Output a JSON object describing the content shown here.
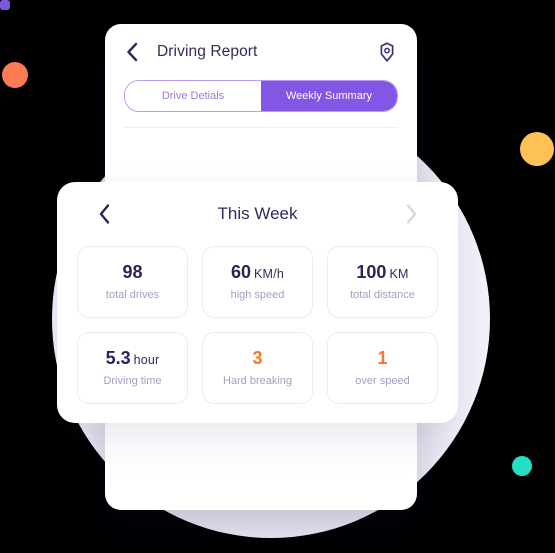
{
  "colors": {
    "accent_purple": "#8257E5",
    "tab_border": "#B89BF0",
    "text_dark": "#312A5B",
    "text_muted": "#A79CC4",
    "orange": "#F4762F",
    "blob_orange": "#FD7B54",
    "blob_amber": "#FDC154",
    "blob_teal": "#25DFC3",
    "blob_square_purple": "#7E57E0",
    "halo": "#F3F1FA"
  },
  "phone": {
    "header": {
      "back_icon": "chevron-left-icon",
      "title": "Driving Report",
      "settings_icon": "gear-icon"
    },
    "tabs": [
      {
        "label": "Drive Detials",
        "active": false
      },
      {
        "label": "Weekly Summary",
        "active": true
      }
    ]
  },
  "panel": {
    "nav": {
      "prev_icon": "chevron-left-icon",
      "label": "This Week",
      "next_icon": "chevron-right-icon"
    },
    "stats": [
      {
        "value": "98",
        "unit": "",
        "label": "total drives",
        "color": "dark"
      },
      {
        "value": "60",
        "unit": "KM/h",
        "label": "high speed",
        "color": "dark"
      },
      {
        "value": "100",
        "unit": "KM",
        "label": "total distance",
        "color": "dark"
      },
      {
        "value": "5.3",
        "unit": "hour",
        "label": "Driving time",
        "color": "dark"
      },
      {
        "value": "3",
        "unit": "",
        "label": "Hard breaking",
        "color": "orange"
      },
      {
        "value": "1",
        "unit": "",
        "label": "over speed",
        "color": "orange"
      }
    ]
  }
}
